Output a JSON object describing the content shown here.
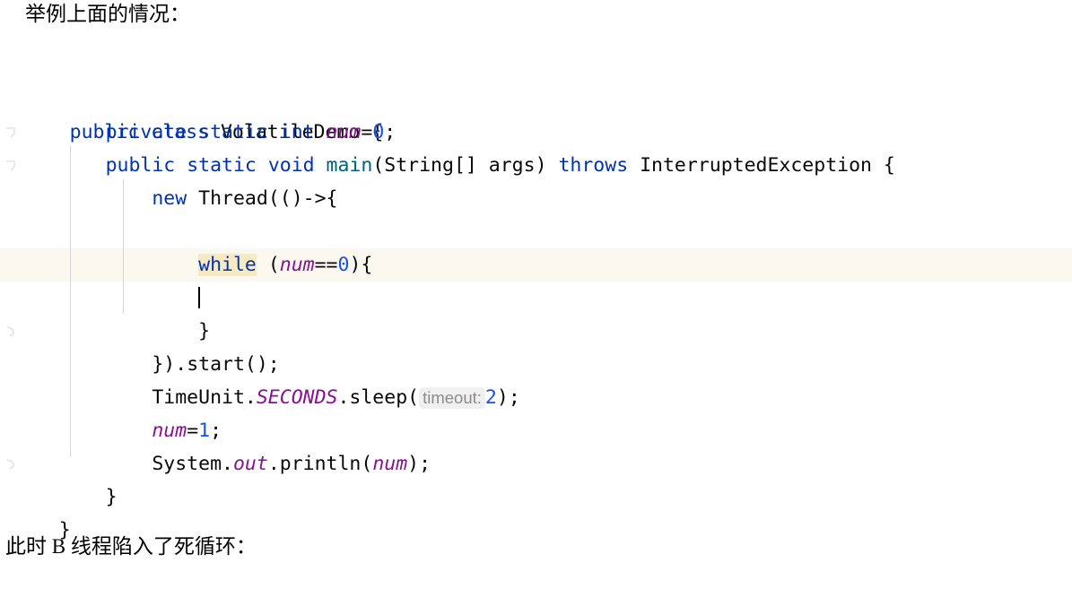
{
  "prose": {
    "top": "举例上面的情况：",
    "bottom": "此时 B 线程陷入了死循环："
  },
  "editor": {
    "background_color": "#ffffff",
    "current_line_highlight_color": "#fbf8ef",
    "token_highlight_color": "#f7e9c0",
    "indent_guide_color": "#d4d4d4",
    "caret_line_index": 5,
    "highlighted_token": "while",
    "language": "java",
    "palette": {
      "keyword": "#0033b3",
      "class_name": "#080808",
      "field": "#871094",
      "method_declaration": "#00627a",
      "number": "#1750eb",
      "punctuation": "#080808",
      "param_hint_text": "#8c8c8c",
      "param_hint_background": "#f0f0f0"
    },
    "lines": [
      {
        "indent": 0,
        "text": "public class VolatileDemo {"
      },
      {
        "indent": 1,
        "text": "private static int num=0;"
      },
      {
        "indent": 1,
        "text": "public static void main(String[] args) throws InterruptedException {"
      },
      {
        "indent": 2,
        "text": "new Thread(()->{"
      },
      {
        "indent": 3,
        "text": ""
      },
      {
        "indent": 3,
        "text": "while (num==0){"
      },
      {
        "indent": 4,
        "text": ""
      },
      {
        "indent": 3,
        "text": "}"
      },
      {
        "indent": 2,
        "text": "}).start();"
      },
      {
        "indent": 2,
        "text": "TimeUnit.SECONDS.sleep( timeout: 2);"
      },
      {
        "indent": 2,
        "text": "num=1;"
      },
      {
        "indent": 2,
        "text": "System.out.println(num);"
      },
      {
        "indent": 1,
        "text": "}"
      },
      {
        "indent": 0,
        "text": "}"
      }
    ],
    "parameter_hints": [
      {
        "label": "timeout:",
        "value": "2"
      }
    ],
    "fold_markers": [
      {
        "line_index": 2
      },
      {
        "line_index": 3
      },
      {
        "line_index": 8
      },
      {
        "line_index": 12
      }
    ]
  }
}
